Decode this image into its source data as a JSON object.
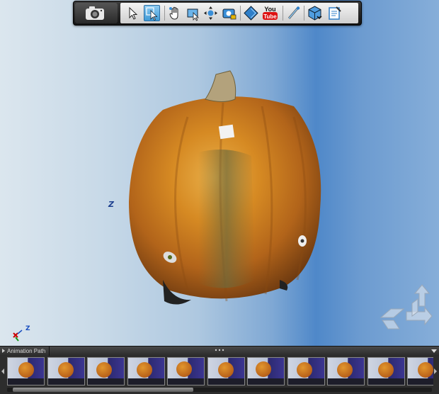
{
  "toolbar": {
    "camera": "camera-icon",
    "tools": [
      "select-arrow-icon",
      "orbit-select-icon",
      "pan-hand-icon",
      "frame-icon",
      "orbit-icon",
      "snapshot-lock-icon",
      "tag-icon",
      "youtube-icon",
      "measure-icon",
      "scene-cube-icon",
      "notes-icon"
    ],
    "youtube_label_top": "You",
    "youtube_label_bottom": "Tube"
  },
  "viewport": {
    "axis_label": "Z",
    "mini_axes": {
      "z": "Z"
    }
  },
  "bottom_panel": {
    "title": "Animation Path",
    "thumbnail_count": 11
  },
  "colors": {
    "toolbar_active": "#3f9ad6",
    "background_blue": "#4f88c9"
  }
}
